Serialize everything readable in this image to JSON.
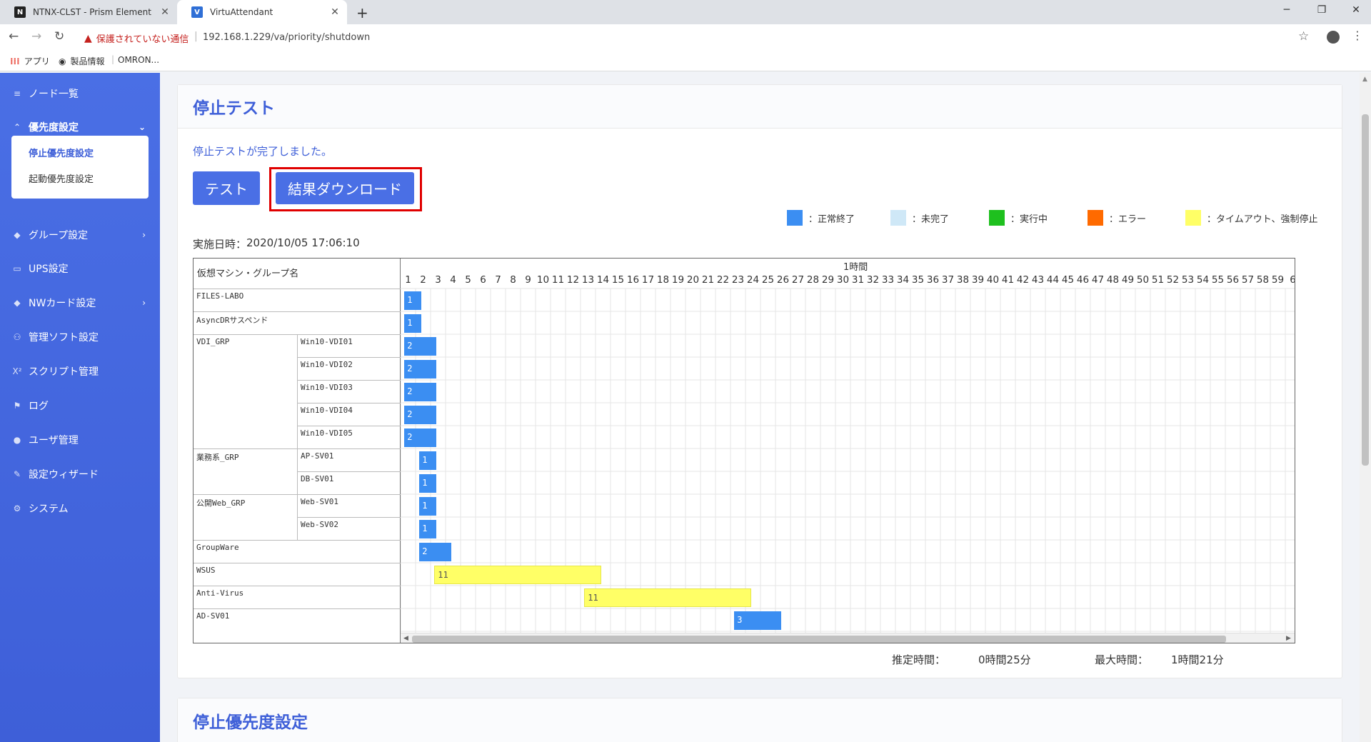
{
  "browser": {
    "tabs": [
      {
        "favicon": "N",
        "title": "NTNX-CLST - Prism Element",
        "active": false
      },
      {
        "favicon": "V",
        "title": "VirtuAttendant",
        "active": true
      }
    ],
    "new_tab": "+",
    "window_controls": {
      "minimize": "─",
      "restore": "❐",
      "close": "✕"
    },
    "nav": {
      "back": "←",
      "forward": "→",
      "reload": "↻"
    },
    "security_warning": "保護されていない通信",
    "url": "192.168.1.229/va/priority/shutdown",
    "bookmarks": [
      {
        "icon": "apps-grid-icon",
        "label": "アプリ"
      },
      {
        "icon": "globe-icon",
        "label": "製品情報"
      },
      {
        "icon": "",
        "label": "OMRON..."
      }
    ]
  },
  "sidebar": {
    "items": [
      {
        "icon": "list-icon",
        "glyph": "≡",
        "label": "ノード一覧",
        "top": 0
      },
      {
        "icon": "chevrons-up-icon",
        "glyph": "⌃",
        "label": "優先度設定",
        "expanded": true
      },
      {
        "icon": "layers-icon",
        "glyph": "◆",
        "label": "グループ設定",
        "arrow": "›"
      },
      {
        "icon": "battery-icon",
        "glyph": "▭",
        "label": "UPS設定"
      },
      {
        "icon": "layers-icon",
        "glyph": "◆",
        "label": "NWカード設定",
        "arrow": "›"
      },
      {
        "icon": "sitemap-icon",
        "glyph": "⚇",
        "label": "管理ソフト設定"
      },
      {
        "icon": "script-icon",
        "glyph": "X²",
        "label": "スクリプト管理"
      },
      {
        "icon": "flag-icon",
        "glyph": "⚑",
        "label": "ログ"
      },
      {
        "icon": "user-icon",
        "glyph": "●",
        "label": "ユーザ管理"
      },
      {
        "icon": "edit-icon",
        "glyph": "✎",
        "label": "設定ウィザード"
      },
      {
        "icon": "gear-icon",
        "glyph": "⚙",
        "label": "システム"
      }
    ],
    "submenu": [
      "停止優先度設定",
      "起動優先度設定"
    ]
  },
  "card1": {
    "title": "停止テスト",
    "status_message": "停止テストが完了しました。",
    "test_button": "テスト",
    "download_button": "結果ダウンロード",
    "exec_label": "実施日時：",
    "exec_datetime": "2020/10/05 17:06:10",
    "legend": [
      {
        "color": "#3b8ef2",
        "label": "：正常終了"
      },
      {
        "color": "#cfe8f7",
        "label": "：未完了"
      },
      {
        "color": "#1ec01e",
        "label": "：実行中"
      },
      {
        "color": "#ff6a00",
        "label": "：エラー"
      },
      {
        "color": "#ffff66",
        "label": "：タイムアウト、強制停止"
      }
    ],
    "estimated_label": "推定時間：",
    "estimated_value": "0時間25分",
    "max_label": "最大時間：",
    "max_value": "1時間21分"
  },
  "chart_data": {
    "type": "gantt",
    "left_header": "仮想マシン・グループ名",
    "time_header": "1時間",
    "unit": "minutes",
    "minute_labels": [
      "1",
      "2",
      "3",
      "4",
      "5",
      "6",
      "7",
      "8",
      "9",
      "10",
      "11",
      "12",
      "13",
      "14",
      "15",
      "16",
      "17",
      "18",
      "19",
      "20",
      "21",
      "22",
      "23",
      "24",
      "25",
      "26",
      "27",
      "28",
      "29",
      "30",
      "31",
      "32",
      "33",
      "34",
      "35",
      "36",
      "37",
      "38",
      "39",
      "40",
      "41",
      "42",
      "43",
      "44",
      "45",
      "46",
      "47",
      "48",
      "49",
      "50",
      "51",
      "52",
      "53",
      "54",
      "55",
      "56",
      "57",
      "58",
      "59",
      "6"
    ],
    "rows": [
      {
        "group": "FILES-LABO",
        "vm": "",
        "start": 0.25,
        "duration": 1,
        "label": "1",
        "status": "normal"
      },
      {
        "group": "AsyncDRサスペンド",
        "vm": "",
        "start": 0.25,
        "duration": 1,
        "label": "1",
        "status": "normal"
      },
      {
        "group": "VDI_GRP",
        "vm": "Win10-VDI01",
        "start": 0.25,
        "duration": 2,
        "label": "2",
        "status": "normal"
      },
      {
        "group": "",
        "vm": "Win10-VDI02",
        "start": 0.25,
        "duration": 2,
        "label": "2",
        "status": "normal"
      },
      {
        "group": "",
        "vm": "Win10-VDI03",
        "start": 0.25,
        "duration": 2,
        "label": "2",
        "status": "normal"
      },
      {
        "group": "",
        "vm": "Win10-VDI04",
        "start": 0.25,
        "duration": 2,
        "label": "2",
        "status": "normal"
      },
      {
        "group": "",
        "vm": "Win10-VDI05",
        "start": 0.25,
        "duration": 2,
        "label": "2",
        "status": "normal"
      },
      {
        "group": "業務系_GRP",
        "vm": "AP-SV01",
        "start": 1.25,
        "duration": 1,
        "label": "1",
        "status": "normal"
      },
      {
        "group": "",
        "vm": "DB-SV01",
        "start": 1.25,
        "duration": 1,
        "label": "1",
        "status": "normal"
      },
      {
        "group": "公開Web_GRP",
        "vm": "Web-SV01",
        "start": 1.25,
        "duration": 1,
        "label": "1",
        "status": "normal"
      },
      {
        "group": "",
        "vm": "Web-SV02",
        "start": 1.25,
        "duration": 1,
        "label": "1",
        "status": "normal"
      },
      {
        "group": "GroupWare",
        "vm": "",
        "start": 1.25,
        "duration": 2,
        "label": "2",
        "status": "normal"
      },
      {
        "group": "WSUS",
        "vm": "",
        "start": 2.25,
        "duration": 11,
        "label": "11",
        "status": "timeout"
      },
      {
        "group": "Anti-Virus",
        "vm": "",
        "start": 12.25,
        "duration": 11,
        "label": "11",
        "status": "timeout"
      },
      {
        "group": "AD-SV01",
        "vm": "",
        "start": 22.25,
        "duration": 3,
        "label": "3",
        "status": "normal"
      }
    ]
  },
  "card2": {
    "title": "停止優先度設定"
  }
}
